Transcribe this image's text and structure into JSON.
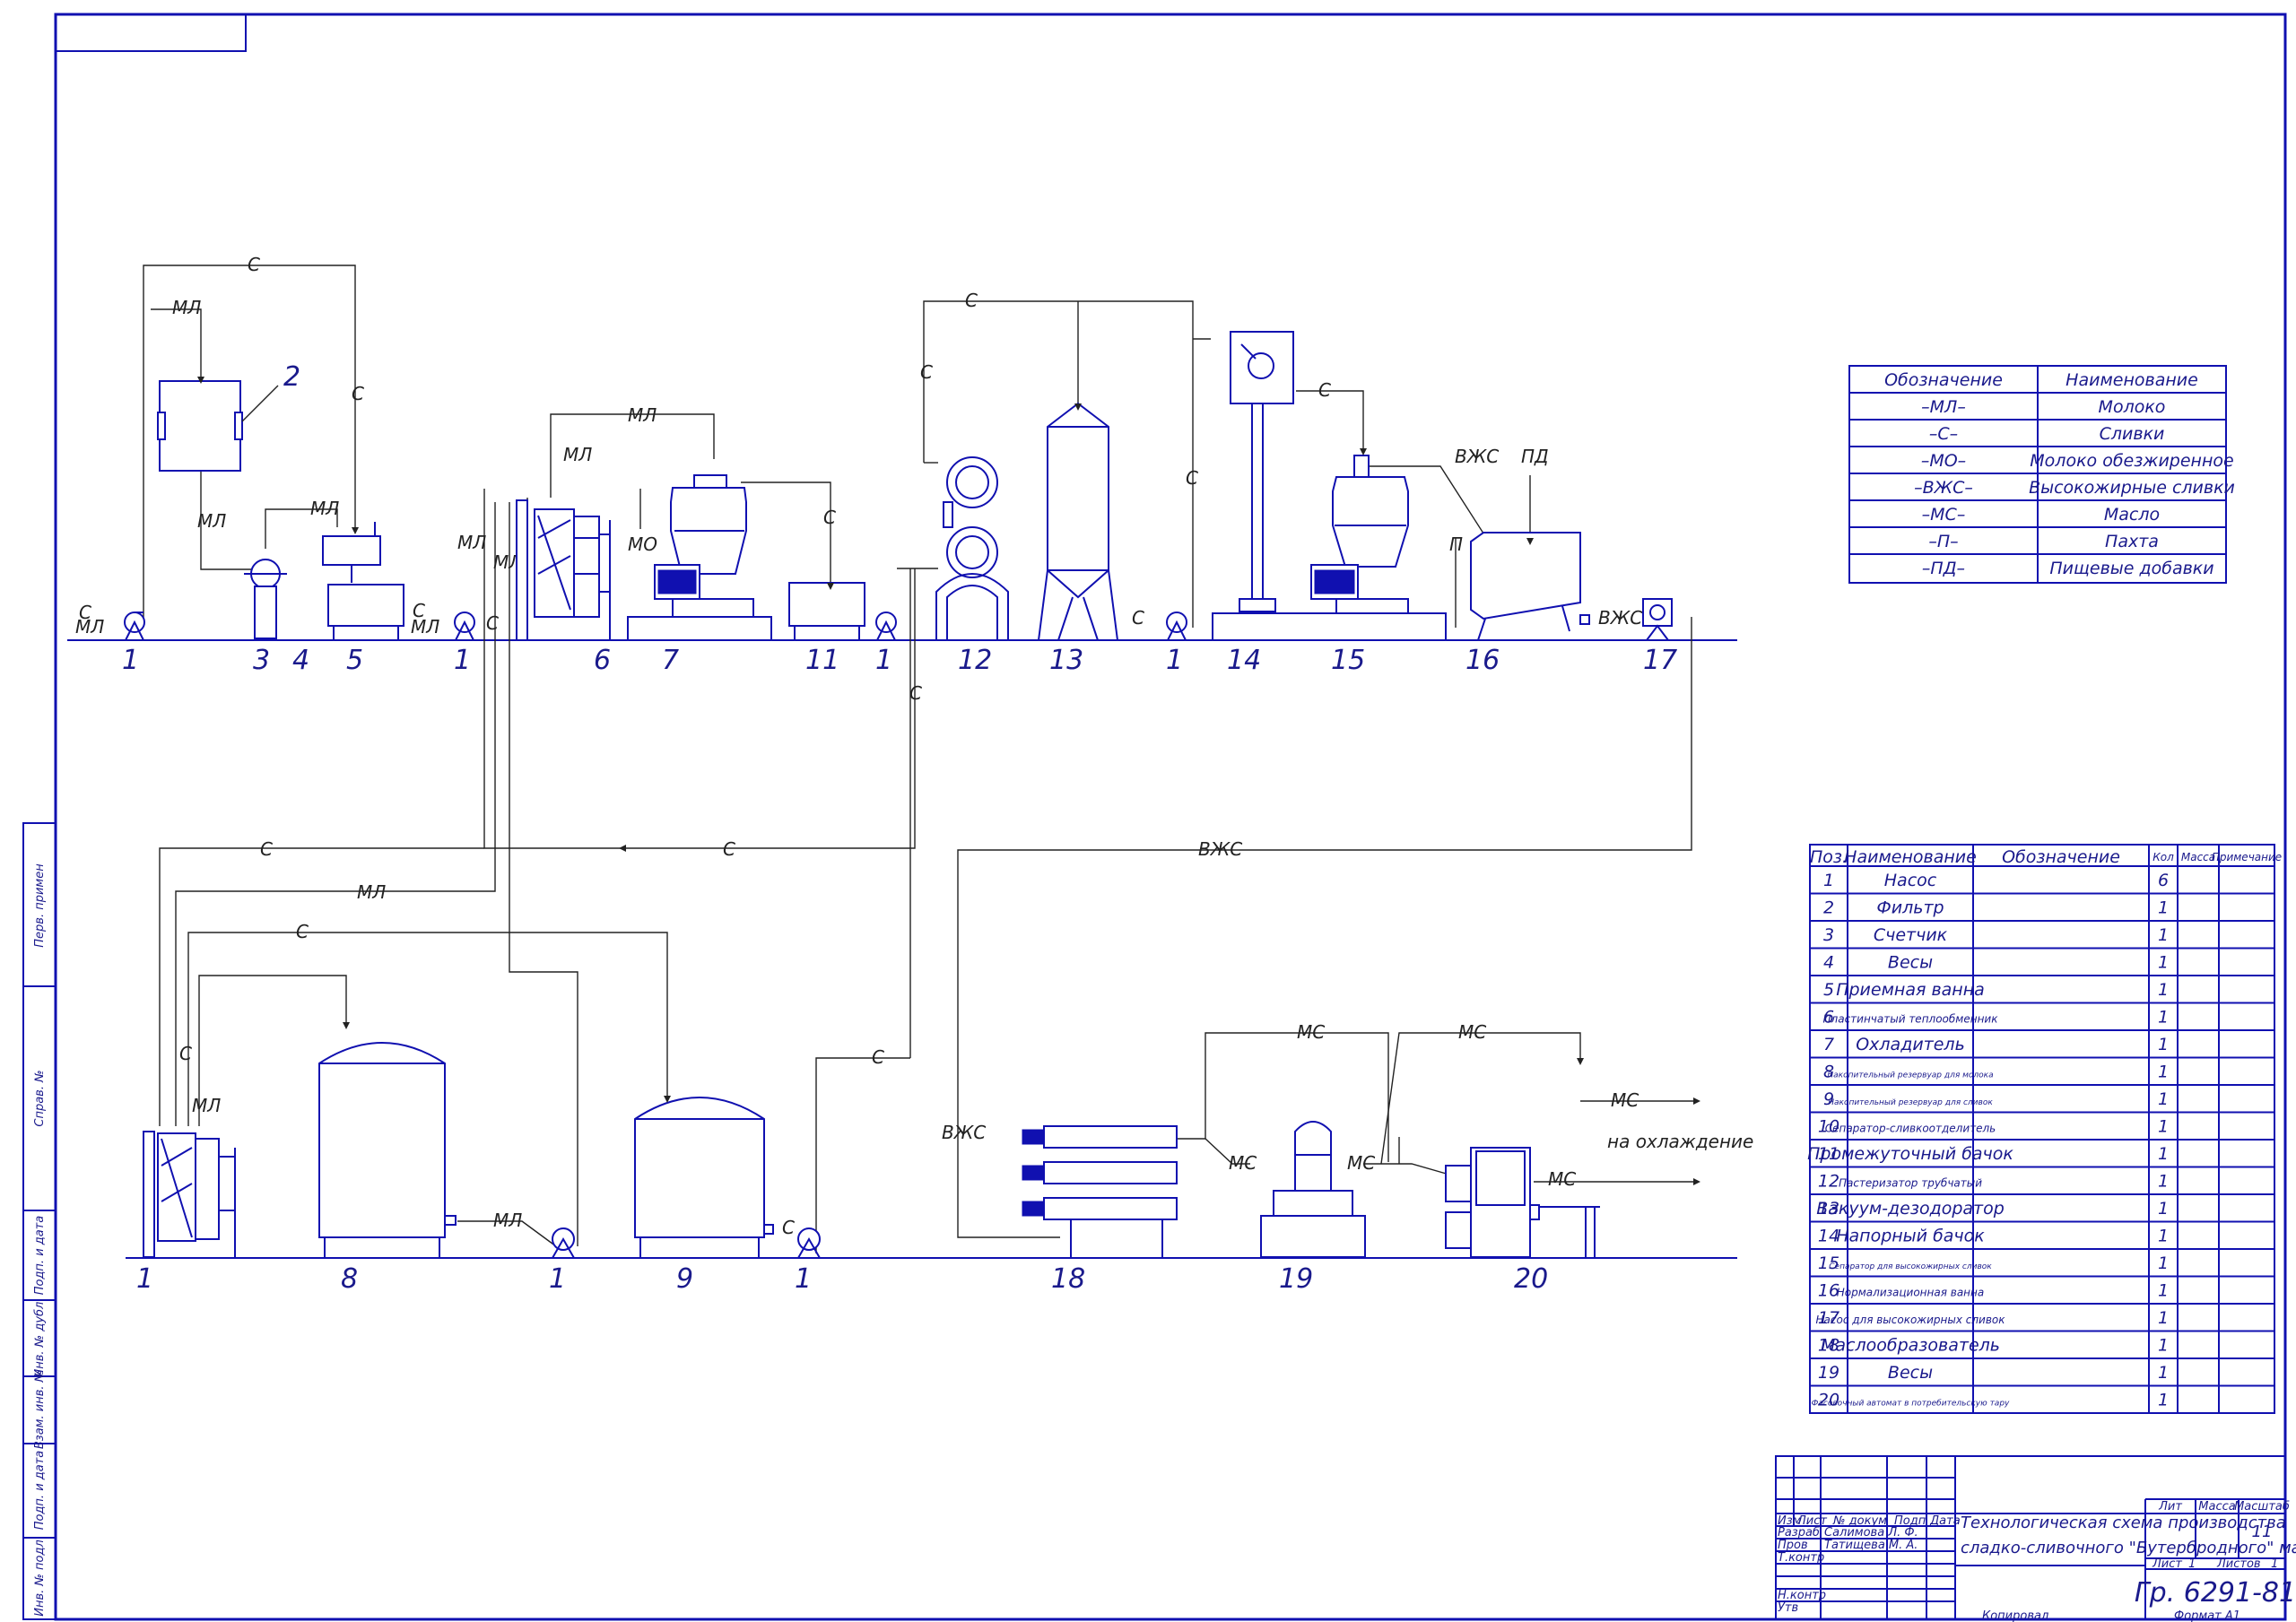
{
  "legend": {
    "headers": [
      "Обозначение",
      "Наименование"
    ],
    "rows": [
      {
        "code": "–МЛ–",
        "name": "Молоко"
      },
      {
        "code": "–С–",
        "name": "Сливки"
      },
      {
        "code": "–МО–",
        "name": "Молоко обезжиренное"
      },
      {
        "code": "–ВЖС–",
        "name": "Высокожирные сливки"
      },
      {
        "code": "–МС–",
        "name": "Масло"
      },
      {
        "code": "–П–",
        "name": "Пахта"
      },
      {
        "code": "–ПД–",
        "name": "Пищевые добавки"
      }
    ]
  },
  "spec": {
    "headers": [
      "Поз.",
      "Наименование",
      "Обозначение",
      "Кол",
      "Масса",
      "Примечание"
    ],
    "rows": [
      {
        "pos": "1",
        "name": "Насос",
        "qty": "6"
      },
      {
        "pos": "2",
        "name": "Фильтр",
        "qty": "1"
      },
      {
        "pos": "3",
        "name": "Счетчик",
        "qty": "1"
      },
      {
        "pos": "4",
        "name": "Весы",
        "qty": "1"
      },
      {
        "pos": "5",
        "name": "Приемная ванна",
        "qty": "1"
      },
      {
        "pos": "6",
        "name": "Пластинчатый теплообменник",
        "qty": "1"
      },
      {
        "pos": "7",
        "name": "Охладитель",
        "qty": "1"
      },
      {
        "pos": "8",
        "name": "Накопительный резервуар для молока",
        "qty": "1"
      },
      {
        "pos": "9",
        "name": "Накопительный резервуар для сливок",
        "qty": "1"
      },
      {
        "pos": "10",
        "name": "Сепаратор-сливкоотделитель",
        "qty": "1"
      },
      {
        "pos": "11",
        "name": "Промежуточный бачок",
        "qty": "1"
      },
      {
        "pos": "12",
        "name": "Пастеризатор трубчатый",
        "qty": "1"
      },
      {
        "pos": "13",
        "name": "Вакуум-дезодоратор",
        "qty": "1"
      },
      {
        "pos": "14",
        "name": "Напорный бачок",
        "qty": "1"
      },
      {
        "pos": "15",
        "name": "Сепаратор для высокожирных сливок",
        "qty": "1"
      },
      {
        "pos": "16",
        "name": "Нормализационная ванна",
        "qty": "1"
      },
      {
        "pos": "17",
        "name": "Насос для высокожирных сливок",
        "qty": "1"
      },
      {
        "pos": "18",
        "name": "Маслообразователь",
        "qty": "1"
      },
      {
        "pos": "19",
        "name": "Весы",
        "qty": "1"
      },
      {
        "pos": "20",
        "name": "Фасовочный автомат в потребительскую тару",
        "qty": "1"
      }
    ]
  },
  "stamp": {
    "title_line1": "Технологическая схема производства",
    "title_line2": "сладко-сливочного \"Бутербродного\" масла",
    "code": "Гр. 6291-81",
    "sheets_value": "11",
    "sheet_label": "Лист",
    "sheet_num": "1",
    "sheets_label": "Листов",
    "lit": "Лит",
    "mass": "Масса",
    "scale": "Масштаб",
    "cols": [
      "Изм",
      "Лист",
      "№ докум",
      "Подп",
      "Дата"
    ],
    "roles": [
      "Разраб",
      "Пров",
      "Т.контр",
      "",
      "Н.контр",
      "Утв"
    ],
    "developer": "Салимова Л. Ф.",
    "checker": "Татищева М. А.",
    "copied": "Копировал",
    "format": "Формат   А1"
  },
  "side_labels": [
    "Перв. примен",
    "Справ. №",
    "Подп. и дата",
    "Инв. № дубл.",
    "Взам. инв. №",
    "Подп. и дата",
    "Инв. № подл"
  ],
  "lines": {
    "ml": "МЛ",
    "s": "С",
    "mo": "МО",
    "vzhs": "ВЖС",
    "ms": "МС",
    "p": "П",
    "pd": "ПД",
    "in_c": "С",
    "in_ml": "МЛ",
    "to_cooling": "на охлаждение"
  },
  "positions": [
    "1",
    "2",
    "3",
    "4",
    "5",
    "1",
    "6",
    "7",
    "11",
    "1",
    "12",
    "13",
    "1",
    "14",
    "15",
    "16",
    "17",
    "1",
    "8",
    "1",
    "9",
    "1",
    "18",
    "19",
    "20"
  ],
  "colors": {
    "drawing": "#1010b0",
    "leader": "#222222"
  }
}
